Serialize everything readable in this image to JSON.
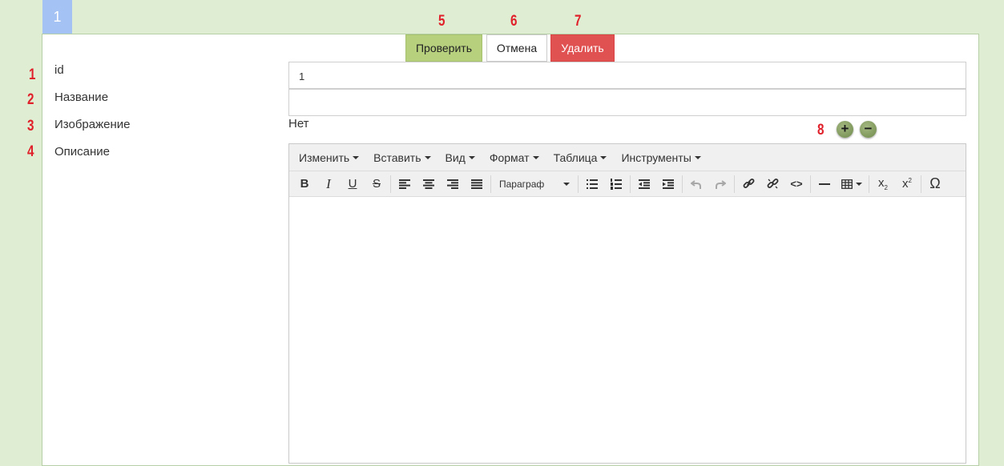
{
  "tab": {
    "number": "1"
  },
  "annotations": {
    "a1": "1",
    "a2": "2",
    "a3": "3",
    "a4": "4",
    "a5": "5",
    "a6": "6",
    "a7": "7",
    "a8": "8"
  },
  "actions": {
    "check": "Проверить",
    "cancel": "Отмена",
    "delete": "Удалить"
  },
  "form": {
    "id_label": "id",
    "id_value": "1",
    "name_label": "Название",
    "name_value": "",
    "image_label": "Изображение",
    "image_value": "Нет",
    "description_label": "Описание"
  },
  "image_controls": {
    "add": "+",
    "remove": "−"
  },
  "editor": {
    "menus": [
      "Изменить",
      "Вставить",
      "Вид",
      "Формат",
      "Таблица",
      "Инструменты"
    ],
    "format_select": "Параграф",
    "bold": "B",
    "italic": "I",
    "underline": "U",
    "strike": "S",
    "subscript": "x",
    "superscript": "x",
    "omega": "Ω",
    "code": "<>"
  },
  "colors": {
    "background": "#dfeed2",
    "tab": "#a4c2f4",
    "check_button": "#b6d07e",
    "delete_button": "#e05252",
    "annotation": "#e0202a"
  }
}
